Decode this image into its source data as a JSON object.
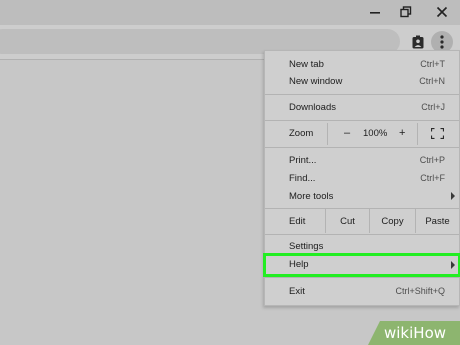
{
  "menu": {
    "new_tab": {
      "label": "New tab",
      "shortcut": "Ctrl+T"
    },
    "new_window": {
      "label": "New window",
      "shortcut": "Ctrl+N"
    },
    "downloads": {
      "label": "Downloads",
      "shortcut": "Ctrl+J"
    },
    "zoom": {
      "label": "Zoom",
      "minus": "–",
      "value": "100%",
      "plus": "+"
    },
    "print": {
      "label": "Print...",
      "shortcut": "Ctrl+P"
    },
    "find": {
      "label": "Find...",
      "shortcut": "Ctrl+F"
    },
    "more_tools": {
      "label": "More tools"
    },
    "edit": {
      "label": "Edit",
      "cut": "Cut",
      "copy": "Copy",
      "paste": "Paste"
    },
    "settings": {
      "label": "Settings"
    },
    "help": {
      "label": "Help"
    },
    "exit": {
      "label": "Exit",
      "shortcut": "Ctrl+Shift+Q"
    }
  },
  "highlight_color": "#22ee22",
  "watermark": {
    "brand": "wikiHow"
  },
  "icons": [
    "minimize-icon",
    "maximize-icon",
    "close-icon",
    "profile-badge-icon",
    "kebab-menu-icon",
    "fullscreen-icon",
    "submenu-arrow-icon"
  ]
}
